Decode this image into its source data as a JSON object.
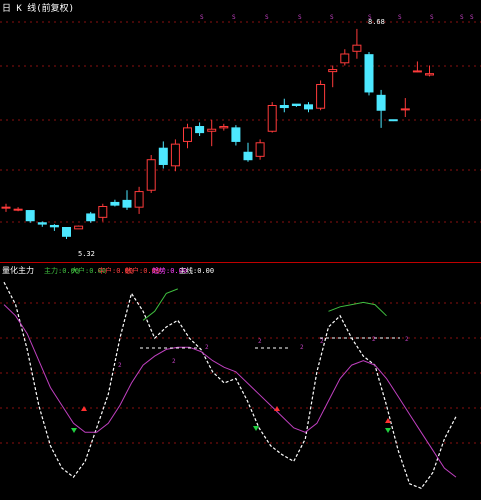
{
  "colors": {
    "background": "#000000",
    "grid": "#8a1010",
    "up_candle": "#ff3b3b",
    "down_candle": "#4de8ff",
    "white_line": "#ffffff",
    "magenta_line": "#c040c0",
    "green_line": "#40c040",
    "marker_red": "#ff3030",
    "marker_green": "#20d040",
    "divider": "#c00000"
  },
  "main_panel": {
    "title": "日 K 线(前复权)",
    "high_label": "8.68",
    "low_label": "5.32",
    "signal_labels": [
      "S",
      "S",
      "S",
      "S",
      "S",
      "S",
      "S",
      "S",
      "S",
      "S"
    ]
  },
  "sub_panel": {
    "title": "量化主力",
    "legend": [
      {
        "name": "主力",
        "value": "0.00",
        "color": "#40c040"
      },
      {
        "name": "大户",
        "value": "0.00",
        "color": "#40c040"
      },
      {
        "name": "中户",
        "value": "0.00",
        "color": "#ff4040"
      },
      {
        "name": "散户",
        "value": "0.00",
        "color": "#ff4040"
      },
      {
        "name": "趋势",
        "value": "0.00",
        "color": "#ff40ff"
      },
      {
        "name": "主线",
        "value": "0.00",
        "color": "#ffffff"
      }
    ],
    "markers": [
      {
        "type": "buy",
        "label": "B"
      },
      {
        "type": "buy",
        "label": "B"
      },
      {
        "type": "buy",
        "label": "B"
      },
      {
        "type": "sell",
        "label": "S"
      },
      {
        "type": "sell",
        "label": "S"
      },
      {
        "type": "sell",
        "label": "S"
      }
    ],
    "small_labels": [
      "2",
      "2",
      "2",
      "2",
      "2",
      "2",
      "2",
      "2"
    ]
  },
  "chart_data": [
    {
      "type": "candlestick",
      "title": "",
      "candles": [
        {
          "o": 6.05,
          "h": 6.1,
          "l": 5.98,
          "c": 6.05
        },
        {
          "o": 6.02,
          "h": 6.05,
          "l": 5.99,
          "c": 6.02
        },
        {
          "o": 6.0,
          "h": 6.0,
          "l": 5.82,
          "c": 5.85
        },
        {
          "o": 5.82,
          "h": 5.84,
          "l": 5.76,
          "c": 5.8
        },
        {
          "o": 5.78,
          "h": 5.8,
          "l": 5.7,
          "c": 5.76
        },
        {
          "o": 5.75,
          "h": 5.75,
          "l": 5.58,
          "c": 5.62
        },
        {
          "o": 5.73,
          "h": 5.78,
          "l": 5.73,
          "c": 5.77
        },
        {
          "o": 5.95,
          "h": 5.98,
          "l": 5.82,
          "c": 5.85
        },
        {
          "o": 5.9,
          "h": 6.1,
          "l": 5.84,
          "c": 6.06
        },
        {
          "o": 6.12,
          "h": 6.16,
          "l": 6.06,
          "c": 6.08
        },
        {
          "o": 6.15,
          "h": 6.3,
          "l": 6.01,
          "c": 6.05
        },
        {
          "o": 6.05,
          "h": 6.35,
          "l": 5.95,
          "c": 6.28
        },
        {
          "o": 6.3,
          "h": 6.82,
          "l": 6.26,
          "c": 6.75
        },
        {
          "o": 6.92,
          "h": 7.02,
          "l": 6.62,
          "c": 6.68
        },
        {
          "o": 6.66,
          "h": 7.05,
          "l": 6.58,
          "c": 6.98
        },
        {
          "o": 7.02,
          "h": 7.28,
          "l": 6.92,
          "c": 7.22
        },
        {
          "o": 7.24,
          "h": 7.3,
          "l": 7.1,
          "c": 7.15
        },
        {
          "o": 7.17,
          "h": 7.34,
          "l": 6.95,
          "c": 7.2
        },
        {
          "o": 7.22,
          "h": 7.28,
          "l": 7.18,
          "c": 7.24
        },
        {
          "o": 7.22,
          "h": 7.26,
          "l": 6.96,
          "c": 7.02
        },
        {
          "o": 6.86,
          "h": 7.0,
          "l": 6.72,
          "c": 6.75
        },
        {
          "o": 6.8,
          "h": 7.05,
          "l": 6.75,
          "c": 7.0
        },
        {
          "o": 7.17,
          "h": 7.6,
          "l": 7.15,
          "c": 7.55
        },
        {
          "o": 7.55,
          "h": 7.65,
          "l": 7.45,
          "c": 7.52
        },
        {
          "o": 7.57,
          "h": 7.57,
          "l": 7.53,
          "c": 7.55
        },
        {
          "o": 7.56,
          "h": 7.6,
          "l": 7.45,
          "c": 7.5
        },
        {
          "o": 7.51,
          "h": 7.92,
          "l": 7.48,
          "c": 7.86
        },
        {
          "o": 8.05,
          "h": 8.14,
          "l": 7.82,
          "c": 8.08
        },
        {
          "o": 8.18,
          "h": 8.38,
          "l": 8.14,
          "c": 8.31
        },
        {
          "o": 8.35,
          "h": 8.68,
          "l": 8.24,
          "c": 8.44
        },
        {
          "o": 8.3,
          "h": 8.34,
          "l": 7.7,
          "c": 7.75
        },
        {
          "o": 7.7,
          "h": 7.78,
          "l": 7.22,
          "c": 7.48
        },
        {
          "o": 7.34,
          "h": 7.34,
          "l": 7.32,
          "c": 7.33
        },
        {
          "o": 7.49,
          "h": 7.66,
          "l": 7.38,
          "c": 7.5
        },
        {
          "o": 8.05,
          "h": 8.2,
          "l": 8.04,
          "c": 8.06
        },
        {
          "o": 8.0,
          "h": 8.14,
          "l": 7.98,
          "c": 8.02
        }
      ],
      "ylim": [
        5.3,
        8.9
      ]
    },
    {
      "type": "line",
      "title": "",
      "ylim": [
        0,
        100
      ],
      "series": [
        {
          "name": "",
          "color": "#ffffff",
          "values": [
            95,
            85,
            65,
            40,
            22,
            12,
            8,
            15,
            30,
            45,
            70,
            90,
            82,
            70,
            75,
            78,
            70,
            65,
            55,
            50,
            52,
            42,
            30,
            22,
            18,
            15,
            25,
            55,
            75,
            80,
            70,
            62,
            58,
            40,
            20,
            5,
            3,
            10,
            25,
            35
          ]
        },
        {
          "name": "",
          "color": "#c040c0",
          "values": [
            85,
            80,
            72,
            60,
            48,
            40,
            32,
            28,
            28,
            32,
            40,
            50,
            58,
            62,
            65,
            66,
            66,
            64,
            60,
            57,
            55,
            50,
            45,
            40,
            35,
            30,
            28,
            32,
            42,
            52,
            58,
            60,
            58,
            52,
            44,
            36,
            28,
            20,
            12,
            8
          ]
        },
        {
          "name": "",
          "color": "#40c040",
          "values": [
            null,
            null,
            null,
            null,
            null,
            null,
            null,
            null,
            null,
            null,
            null,
            null,
            78,
            82,
            90,
            92,
            null,
            null,
            null,
            null,
            null,
            null,
            null,
            null,
            null,
            null,
            null,
            null,
            82,
            84,
            85,
            86,
            85,
            80,
            null,
            null,
            null,
            null,
            null,
            null
          ]
        }
      ]
    }
  ]
}
